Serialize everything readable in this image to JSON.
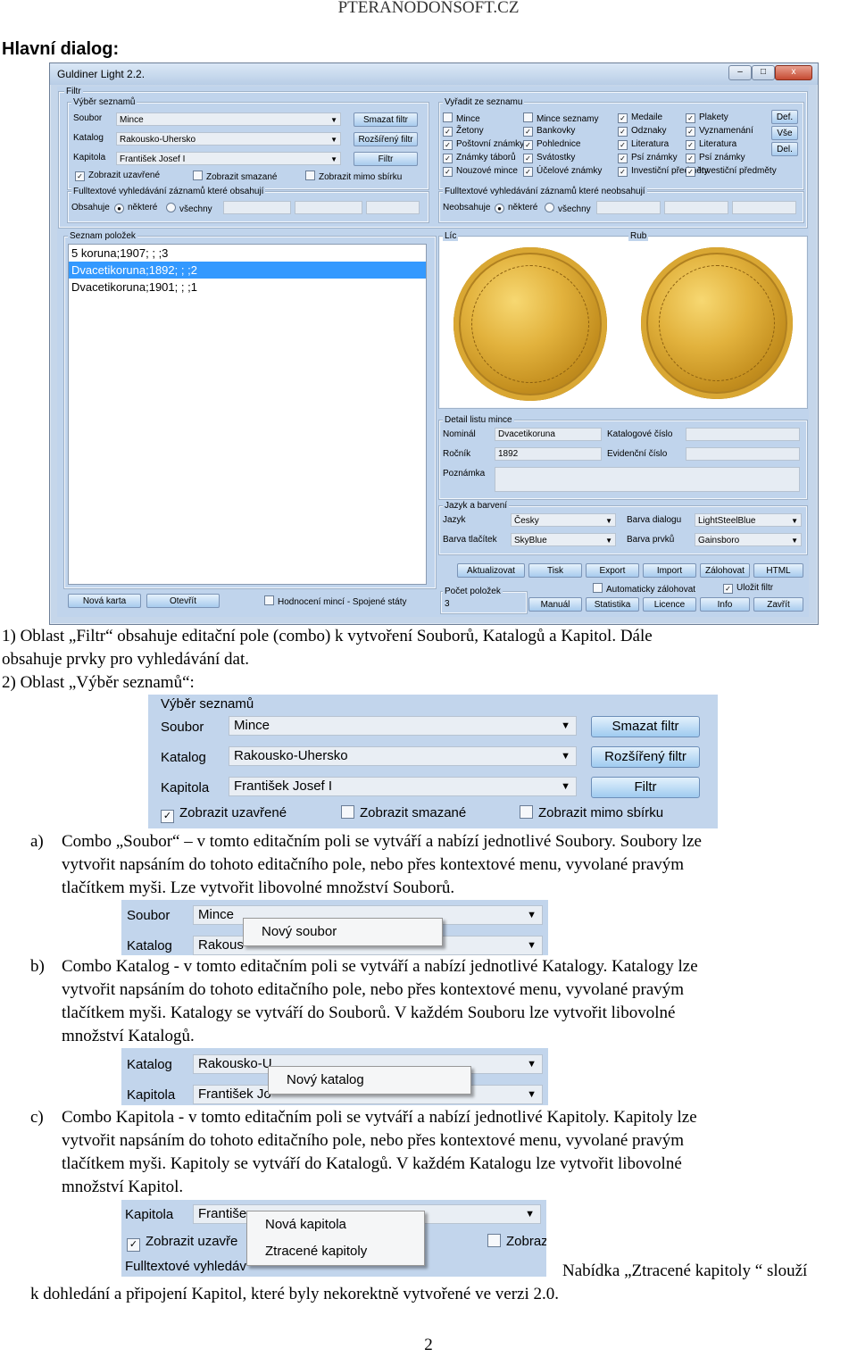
{
  "header": {
    "site": "PTERANODONSOFT.CZ",
    "heading": "Hlavní dialog:"
  },
  "app": {
    "title": "Guldiner Light 2.2.",
    "window_buttons": [
      "–",
      "□",
      "x"
    ],
    "filtr_legend": "Filtr",
    "vyber": {
      "legend": "Výběr seznamů",
      "soubor_label": "Soubor",
      "soubor_value": "Mince",
      "katalog_label": "Katalog",
      "katalog_value": "Rakousko-Uhersko",
      "kapitola_label": "Kapitola",
      "kapitola_value": "František Josef I",
      "btn_smazat": "Smazat filtr",
      "btn_rozsireny": "Rozšířený filtr",
      "btn_filtr": "Filtr",
      "cb_uzavrene": "Zobrazit uzavřené",
      "cb_smazane": "Zobrazit smazané",
      "cb_mimo": "Zobrazit mimo sbírku"
    },
    "vyradit": {
      "legend": "Vyřadit ze seznamu",
      "col1": [
        "Mince",
        "Žetony",
        "Poštovní známky",
        "Známky táborů",
        "Nouzové mince"
      ],
      "col2": [
        "Mince seznamy",
        "Bankovky",
        "Pohlednice",
        "Svátostky",
        "Účelové známky"
      ],
      "col3": [
        "Medaile",
        "Odznaky",
        "Literatura",
        "Psí známky",
        "Investiční předměty"
      ],
      "col4": [
        "Plakety",
        "Vyznamenání",
        "Literatura",
        "Psí známky",
        "Investiční předměty"
      ],
      "btn_def": "Def.",
      "btn_vse": "Vše",
      "btn_del": "Del."
    },
    "fulltext1": {
      "legend": "Fulltextové vyhledávání záznamů které obsahují",
      "label": "Obsahuje",
      "opt1": "některé",
      "opt2": "všechny"
    },
    "fulltext2": {
      "legend": "Fulltextové vyhledávání záznamů které neobsahují",
      "label": "Neobsahuje",
      "opt1": "některé",
      "opt2": "všechny"
    },
    "seznam": {
      "legend": "Seznam položek",
      "items": [
        "5 koruna;1907; ; ;3",
        "Dvacetikoruna;1892; ; ;2",
        "Dvacetikoruna;1901; ; ;1"
      ]
    },
    "lic_legend": "Líc",
    "rub_legend": "Rub",
    "detail": {
      "legend": "Detail listu mince",
      "nominal_label": "Nominál",
      "nominal_value": "Dvacetikoruna",
      "rocnik_label": "Ročník",
      "rocnik_value": "1892",
      "poznamka_label": "Poznámka",
      "katalog_cislo_label": "Katalogové číslo",
      "evidencni_label": "Evidenční číslo"
    },
    "jazyk": {
      "legend": "Jazyk a barvení",
      "jazyk_label": "Jazyk",
      "jazyk_value": "Česky",
      "barva_tlacitek_label": "Barva tlačítek",
      "barva_tlacitek_value": "SkyBlue",
      "barva_dialogu_label": "Barva dialogu",
      "barva_dialogu_value": "LightSteelBlue",
      "barva_prvku_label": "Barva prvků",
      "barva_prvku_value": "Gainsboro"
    },
    "pocet": {
      "legend": "Počet položek",
      "value": "3"
    },
    "bottom": {
      "btn_nova": "Nová karta",
      "btn_otevrit": "Otevřít",
      "cb_hodnoceni": "Hodnocení mincí - Spojené státy",
      "row1": [
        "Aktualizovat",
        "Tisk",
        "Export",
        "Import",
        "Zálohovat",
        "HTML"
      ],
      "cb_auto": "Automaticky zálohovat",
      "cb_ulozit": "Uložit filtr",
      "row2": [
        "Manuál",
        "Statistika",
        "Licence",
        "Info",
        "Zavřít"
      ]
    }
  },
  "text": {
    "p1a": "1) Oblast „Filtr“ obsahuje editační pole (combo) k vytvoření Souborů, Katalogů a Kapitol. Dále",
    "p1b": "obsahuje prvky pro vyhledávání dat.",
    "p2": "2) Oblast „Výběr seznamů“:",
    "a_marker": "a)",
    "a1": "Combo „Soubor“ – v tomto editačním poli se vytváří a nabízí jednotlivé Soubory. Soubory lze",
    "a2": "vytvořit napsáním do tohoto editačního pole, nebo přes kontextové menu, vyvolané pravým",
    "a3": "tlačítkem myši. Lze vytvořit libovolné množství Souborů.",
    "b_marker": "b)",
    "b1": "Combo Katalog - v tomto editačním poli se vytváří a nabízí jednotlivé Katalogy. Katalogy lze",
    "b2": "vytvořit napsáním do tohoto editačního pole, nebo přes kontextové menu, vyvolané pravým",
    "b3": "tlačítkem myši. Katalogy se vytváří do Souborů. V každém Souboru lze vytvořit libovolné",
    "b4": "množství Katalogů.",
    "c_marker": "c)",
    "c1": "Combo Kapitola - v tomto editačním poli se vytváří a nabízí jednotlivé Kapitoly. Kapitoly lze",
    "c2": "vytvořit napsáním do tohoto editačního pole, nebo přes kontextové menu, vyvolané pravým",
    "c3": "tlačítkem myši. Kapitoly se vytváří do Katalogů. V každém Katalogu lze vytvořit libovolné",
    "c4": "množství Kapitol.",
    "n1": "Nabídka „Ztracené kapitoly “ slouží",
    "n2": "k dohledání a připojení Kapitol, které byly nekorektně vytvořené ve verzi 2.0.",
    "page": "2"
  },
  "crop1": {
    "legend": "Výběr seznamů",
    "soubor_label": "Soubor",
    "soubor_value": "Mince",
    "katalog_label": "Katalog",
    "katalog_value": "Rakousko-Uhersko",
    "kapitola_label": "Kapitola",
    "kapitola_value": "František Josef I",
    "btn1": "Smazat filtr",
    "btn2": "Rozšířený filtr",
    "btn3": "Filtr",
    "cb1": "Zobrazit uzavřené",
    "cb2": "Zobrazit smazané",
    "cb3": "Zobrazit mimo sbírku"
  },
  "crop2": {
    "label1": "Soubor",
    "value1": "Mince",
    "label2": "Katalog",
    "value2": "Rakous",
    "menu": [
      "Nový soubor"
    ]
  },
  "crop3": {
    "label1": "Katalog",
    "value1": "Rakousko-U",
    "label2": "Kapitola",
    "value2": "František Jo",
    "menu": [
      "Nový katalog"
    ]
  },
  "crop4": {
    "label1": "Kapitola",
    "value1": "Františe",
    "cb1": "Zobrazit uzavře",
    "cb2": "Zobraz",
    "label3": "Fulltextové vyhledáv",
    "menu": [
      "Nová kapitola",
      "Ztracené kapitoly"
    ]
  }
}
